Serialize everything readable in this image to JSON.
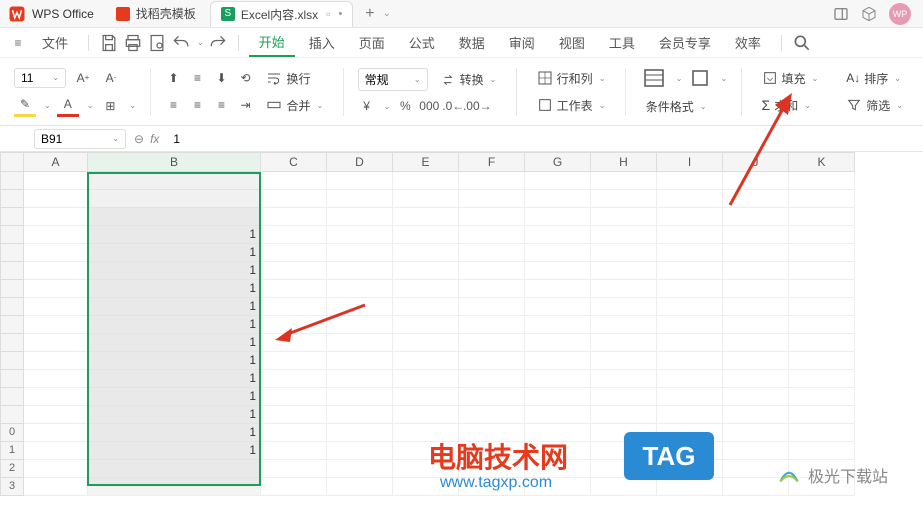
{
  "app": {
    "name": "WPS Office"
  },
  "tabs": [
    {
      "label": "找稻壳模板",
      "icon_color": "#e63a1e"
    },
    {
      "label": "Excel内容.xlsx",
      "icon_color": "#1a9e5c",
      "active": true
    }
  ],
  "titlebar": {
    "new_tab": "+",
    "avatar": "WP"
  },
  "menubar": {
    "file": "文件",
    "tabs": [
      "开始",
      "插入",
      "页面",
      "公式",
      "数据",
      "审阅",
      "视图",
      "工具",
      "会员专享",
      "效率"
    ],
    "active_index": 0
  },
  "ribbon": {
    "font_size": "11",
    "wrap": "换行",
    "merge": "合并",
    "number_format": "常规",
    "convert": "转换",
    "rows_cols": "行和列",
    "worksheet": "工作表",
    "cond_fmt": "条件格式",
    "fill": "填充",
    "sort": "排序",
    "sum": "求和",
    "filter": "筛选"
  },
  "namebox": {
    "value": "B91"
  },
  "formula": {
    "value": "1"
  },
  "columns": [
    "A",
    "B",
    "C",
    "D",
    "E",
    "F",
    "G",
    "H",
    "I",
    "J",
    "K"
  ],
  "row_headers_tail": [
    "0",
    "1",
    "2",
    "3"
  ],
  "b_values": [
    "1",
    "1",
    "1",
    "1",
    "1",
    "1",
    "1",
    "1",
    "1",
    "1",
    "1",
    "1",
    "1"
  ],
  "chart_data": {
    "type": "table",
    "note": "Column B rows (visible portion) all contain value 1",
    "values": [
      1,
      1,
      1,
      1,
      1,
      1,
      1,
      1,
      1,
      1,
      1,
      1,
      1
    ]
  },
  "watermark": {
    "site1_title": "电脑技术网",
    "site1_url": "www.tagxp.com",
    "site1_tag": "TAG",
    "site2": "极光下载站"
  }
}
